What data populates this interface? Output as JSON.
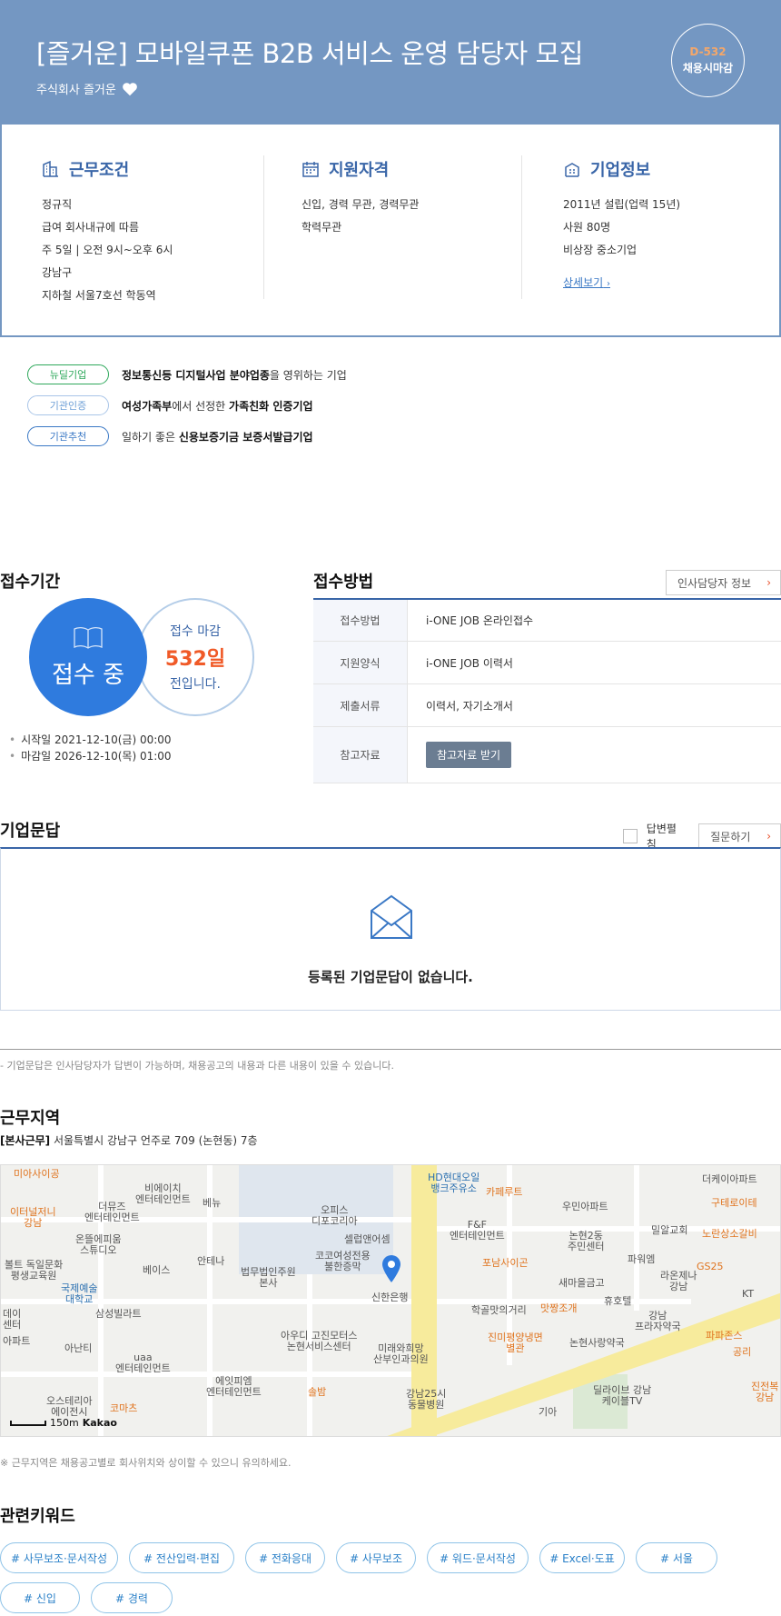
{
  "header": {
    "title": "[즐거운] 모바일쿠폰 B2B 서비스 운영 담당자 모집",
    "company": "주식회사 즐거운",
    "dday": "D-532",
    "dday_status": "채용시마감"
  },
  "conditions": {
    "title": "근무조건",
    "items": [
      "정규직",
      "급여 회사내규에 따름",
      "주 5일 | 오전 9시~오후 6시",
      "강남구",
      "지하철 서울7호선 학동역"
    ]
  },
  "qualifications": {
    "title": "지원자격",
    "items": [
      "신입, 경력 무관, 경력무관",
      "학력무관"
    ]
  },
  "company_info": {
    "title": "기업정보",
    "items": [
      "2011년 설립(업력 15년)",
      "사원 80명",
      "비상장 중소기업"
    ],
    "more_link": "상세보기"
  },
  "badges": [
    {
      "tag": "뉴딜기업",
      "pre": "",
      "bold": "정보통신등 디지털사업 분야업종",
      "post": "을 영위하는 기업"
    },
    {
      "tag": "기관인증",
      "pre": "",
      "bold": "여성가족부",
      "mid": "에서 선정한 ",
      "bold2": "가족친화 인증기업"
    },
    {
      "tag": "기관추천",
      "pre": "일하기 좋은 ",
      "bold": "신용보증기금 보증서발급기업",
      "post": ""
    }
  ],
  "period": {
    "title": "접수기간",
    "status": "접수 중",
    "deadline_label": "접수 마감",
    "days": "532일",
    "suffix": "전입니다.",
    "start": "시작일 2021-12-10(금) 00:00",
    "end": "마감일 2026-12-10(목) 01:00"
  },
  "method": {
    "title": "접수방법",
    "hr_button": "인사담당자 정보",
    "rows": [
      {
        "key": "접수방법",
        "value": "i-ONE JOB 온라인접수"
      },
      {
        "key": "지원양식",
        "value": "i-ONE JOB 이력서"
      },
      {
        "key": "제출서류",
        "value": "이력서, 자기소개서"
      },
      {
        "key": "참고자료",
        "value": "참고자료 받기"
      }
    ]
  },
  "qa": {
    "title": "기업문답",
    "toggle_label": "답변펼침",
    "ask_button": "질문하기",
    "empty": "등록된 기업문답이 없습니다.",
    "note": "- 기업문답은 인사담당자가 답변이 가능하며, 채용공고의 내용과 다른 내용이 있을 수 있습니다."
  },
  "location": {
    "title": "근무지역",
    "addr_label": "[본사근무]",
    "address": "서울특별시 강남구 언주로 709 (논현동) 7층",
    "scale": "150m",
    "provider": "Kakao",
    "note": "※ 근무지역은 채용공고별로 회사위치와 상이할 수 있으니 유의하세요.",
    "map_labels": [
      {
        "t": "미아사이공",
        "c": "orange"
      },
      {
        "t": "비에이치\n엔터테인먼트",
        "c": ""
      },
      {
        "t": "더뮤즈\n엔터테인먼트",
        "c": ""
      },
      {
        "t": "이터널저니\n강남",
        "c": "orange"
      },
      {
        "t": "온뜰에피움\n스튜디오",
        "c": ""
      },
      {
        "t": "볼트 독일문화\n평생교육원",
        "c": ""
      },
      {
        "t": "국제예술\n대학교",
        "c": "blue"
      },
      {
        "t": "베이스",
        "c": ""
      },
      {
        "t": "안테나",
        "c": ""
      },
      {
        "t": "베뉴",
        "c": ""
      },
      {
        "t": "법무법인주원\n본사",
        "c": ""
      },
      {
        "t": "오피스\n디포코리아",
        "c": ""
      },
      {
        "t": "셀럽앤어셈",
        "c": ""
      },
      {
        "t": "코코여성전용\n불한증막",
        "c": ""
      },
      {
        "t": "신한은행",
        "c": ""
      },
      {
        "t": "HD현대오일\n뱅크주유소",
        "c": "blue"
      },
      {
        "t": "카페루트",
        "c": "orange"
      },
      {
        "t": "F&F\n엔터테인먼트",
        "c": ""
      },
      {
        "t": "우민아파트",
        "c": ""
      },
      {
        "t": "더케이아파트",
        "c": ""
      },
      {
        "t": "구테로이테",
        "c": "orange"
      },
      {
        "t": "노란상소갈비",
        "c": "orange"
      },
      {
        "t": "밀알교회",
        "c": ""
      },
      {
        "t": "논현2동\n주민센터",
        "c": ""
      },
      {
        "t": "파워엠",
        "c": ""
      },
      {
        "t": "GS25",
        "c": "orange"
      },
      {
        "t": "포남사이곤",
        "c": "orange"
      },
      {
        "t": "새마을금고",
        "c": ""
      },
      {
        "t": "라온제나\n강남",
        "c": ""
      },
      {
        "t": "KT",
        "c": ""
      },
      {
        "t": "휴호텔",
        "c": ""
      },
      {
        "t": "학골맛의거리",
        "c": ""
      },
      {
        "t": "맛짱조개",
        "c": "orange"
      },
      {
        "t": "강남\n프라자약국",
        "c": ""
      },
      {
        "t": "삼성빌라트",
        "c": ""
      },
      {
        "t": "데이\n센터",
        "c": ""
      },
      {
        "t": "아파트",
        "c": ""
      },
      {
        "t": "아난티",
        "c": ""
      },
      {
        "t": "uaa\n엔터테인먼트",
        "c": ""
      },
      {
        "t": "아우디 고진모터스\n논현서비스센터",
        "c": ""
      },
      {
        "t": "미래와희망\n산부인과의원",
        "c": ""
      },
      {
        "t": "진미평양냉면\n별관",
        "c": "orange"
      },
      {
        "t": "논현사랑약국",
        "c": ""
      },
      {
        "t": "파파존스",
        "c": "orange"
      },
      {
        "t": "공리",
        "c": "orange"
      },
      {
        "t": "에잇피엠\n엔터테인먼트",
        "c": ""
      },
      {
        "t": "솔밤",
        "c": "orange"
      },
      {
        "t": "강남25시\n동물병원",
        "c": ""
      },
      {
        "t": "기아",
        "c": ""
      },
      {
        "t": "딜라이브 강남\n케이블TV",
        "c": ""
      },
      {
        "t": "진전복\n강남",
        "c": "orange"
      },
      {
        "t": "코마츠",
        "c": "orange"
      },
      {
        "t": "오스테리아\n에이전시",
        "c": ""
      }
    ]
  },
  "keywords": {
    "title": "관련키워드",
    "items": [
      "# 사무보조·문서작성",
      "# 전산입력·편집",
      "# 전화응대",
      "# 사무보조",
      "# 워드·문서작성",
      "# Excel·도표",
      "# 서울",
      "# 신입",
      "# 경력"
    ]
  },
  "colors": {
    "header_bg": "#7497c2",
    "accent_blue": "#2f7bde",
    "deadline_orange": "#f05a28"
  }
}
